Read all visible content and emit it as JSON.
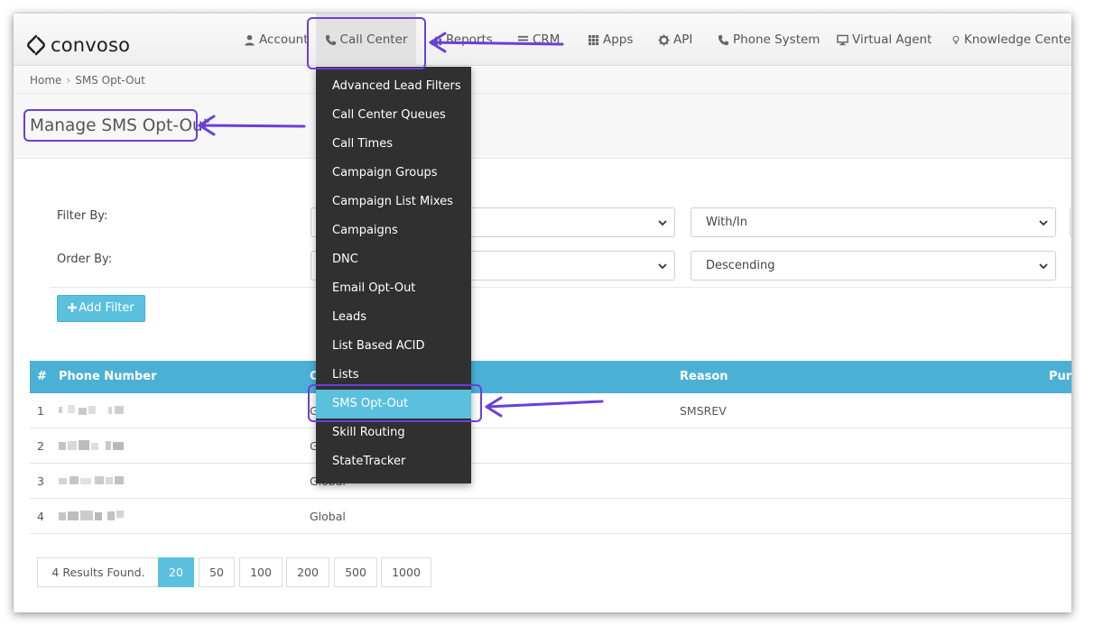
{
  "brand": {
    "name": "convoso",
    "logo_icon": "convoso-logo-icon"
  },
  "nav": {
    "items": [
      {
        "label": "Account",
        "icon": "user-icon"
      },
      {
        "label": "Call Center",
        "icon": "phone-icon",
        "active": true
      },
      {
        "label": "Reports",
        "icon": "chart-icon"
      },
      {
        "label": "CRM",
        "icon": "list-icon"
      },
      {
        "label": "Apps",
        "icon": "grid-icon"
      },
      {
        "label": "API",
        "icon": "gear-icon"
      },
      {
        "label": "Phone System",
        "icon": "phone-icon"
      },
      {
        "label": "Virtual Agent",
        "icon": "monitor-icon"
      },
      {
        "label": "Knowledge Center",
        "icon": "lightbulb-icon"
      }
    ]
  },
  "breadcrumb": {
    "home": "Home",
    "separator": "›",
    "current": "SMS Opt-Out"
  },
  "page_title": "Manage SMS Opt-Out",
  "filters": {
    "filter_label": "Filter By:",
    "order_label": "Order By:",
    "filter_operator": "With/In",
    "order_direction": "Descending",
    "add_filter_label": "Add Filter",
    "add_filter_icon": "plus-icon"
  },
  "dropdown": {
    "items": [
      "Advanced Lead Filters",
      "Call Center Queues",
      "Call Times",
      "Campaign Groups",
      "Campaign List Mixes",
      "Campaigns",
      "DNC",
      "Email Opt-Out",
      "Leads",
      "List Based ACID",
      "Lists",
      "SMS Opt-Out",
      "Skill Routing",
      "StateTracker"
    ],
    "active_index": 11
  },
  "table": {
    "headers": {
      "index": "#",
      "phone": "Phone Number",
      "campaign": "C",
      "reason": "Reason",
      "purpose": "Purp"
    },
    "rows": [
      {
        "index": "1",
        "campaign": "G",
        "reason": "SMSREV"
      },
      {
        "index": "2",
        "campaign": "G",
        "reason": ""
      },
      {
        "index": "3",
        "campaign": "Global",
        "reason": ""
      },
      {
        "index": "4",
        "campaign": "Global",
        "reason": ""
      }
    ]
  },
  "pagination": {
    "results_text": "4 Results Found.",
    "page_sizes": [
      "20",
      "50",
      "100",
      "200",
      "500",
      "1000"
    ],
    "active_size": "20"
  },
  "colors": {
    "accent": "#5bc0de",
    "table_header": "#4bb0d6",
    "dropdown_bg": "#303030",
    "annotation": "#6a3fdc"
  }
}
